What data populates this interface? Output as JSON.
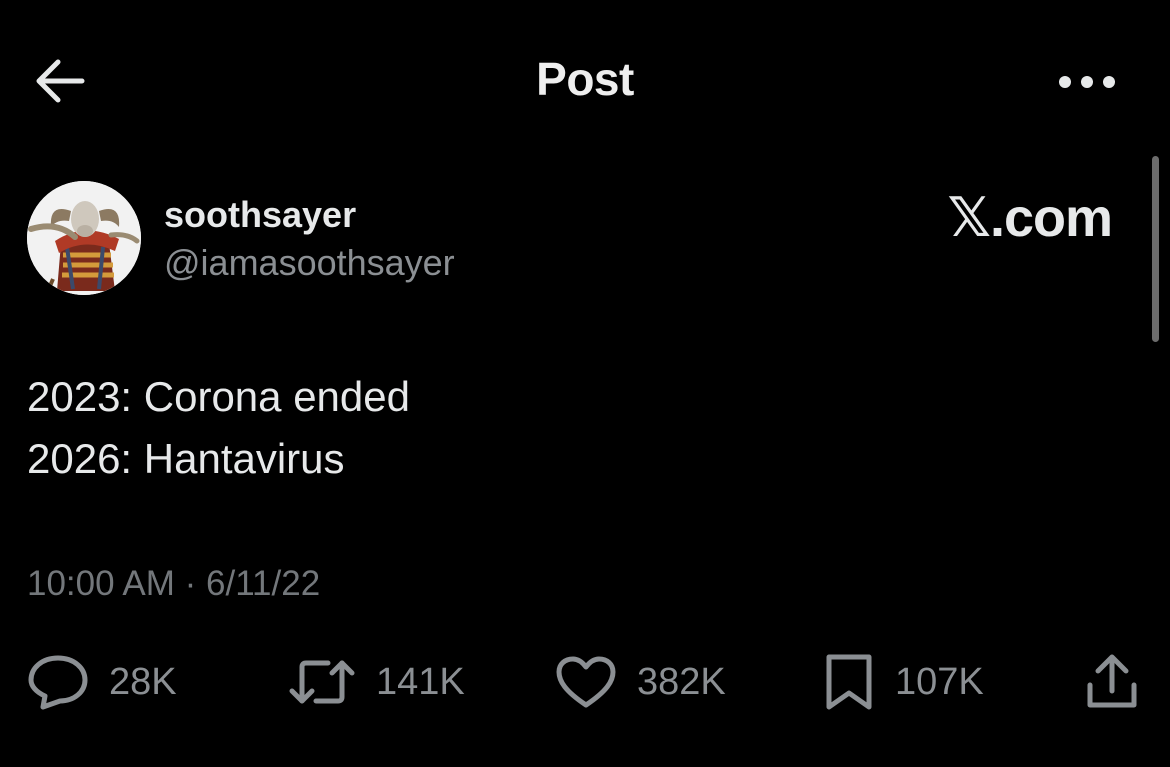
{
  "header": {
    "title": "Post",
    "back_icon": "arrow-left-icon",
    "more_icon": "more-horizontal-icon"
  },
  "author": {
    "name": "soothsayer",
    "handle": "@iamasoothsayer",
    "avatar": "avatar-image"
  },
  "watermark": "𝕏.com",
  "post": {
    "lines": [
      "2023: Corona ended",
      "2026: Hantavirus"
    ],
    "time": "10:00 AM",
    "separator": " · ",
    "date": "6/11/22"
  },
  "actions": {
    "replies": "28K",
    "reposts": "141K",
    "likes": "382K",
    "bookmarks": "107K"
  },
  "colors": {
    "background": "#000000",
    "text": "#e7e9ea",
    "secondary_text": "#8b8f93"
  }
}
